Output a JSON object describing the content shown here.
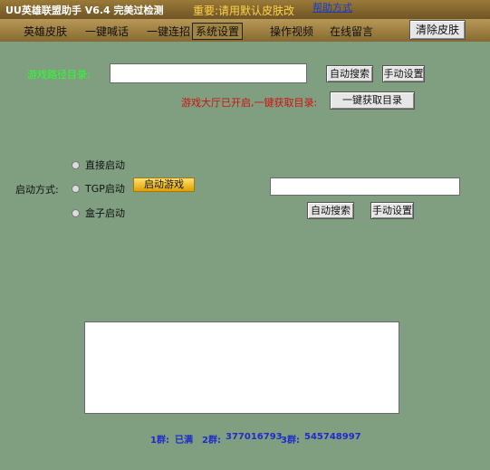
{
  "window": {
    "title": "UU英雄联盟助手 V6.4 完美过检测",
    "notice": "重要:请用默认皮肤改",
    "help_link": "帮助方式"
  },
  "menu": {
    "items": [
      "英雄皮肤",
      "一键喊话",
      "一键连招",
      "系统设置",
      "操作视频",
      "在线留言"
    ],
    "active": "系统设置",
    "clear_skin": "清除皮肤"
  },
  "settings": {
    "game_dir_label": "游戏路径目录:",
    "game_dir_value": "",
    "auto_search": "自动搜索",
    "manual_set": "手动设置",
    "hall_status": "游戏大厅已开启,一键获取目录:",
    "one_click_get_dir": "一键获取目录"
  },
  "launch": {
    "label": "启动方式:",
    "options": [
      "直接启动",
      "TGP启动",
      "盒子启动"
    ],
    "launch_game": "启动游戏",
    "path_value": "",
    "auto_search": "自动搜索",
    "manual_set": "手动设置"
  },
  "log": {
    "text": ""
  },
  "groups": {
    "g1_label": "1群:",
    "g1_value": "已满",
    "g2_label": "2群:",
    "g2_value": "377016793",
    "g3_label": "3群:",
    "g3_value": "545748997"
  },
  "colors": {
    "background": "#7f9f80",
    "title_gold": "#ffd24a",
    "path_label_green": "#2cff2c",
    "status_red": "#d01010",
    "group_blue": "#1f2cc8",
    "launch_button": "#f4c020"
  }
}
